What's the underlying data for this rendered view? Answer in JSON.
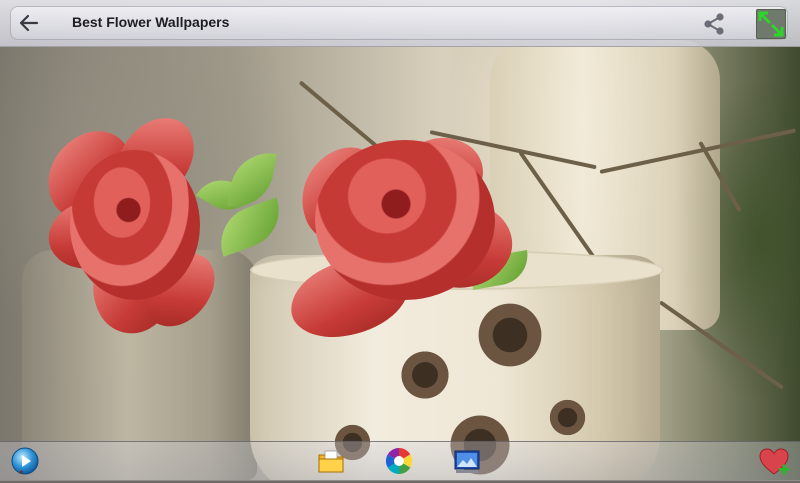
{
  "app": {
    "title": "Best Flower Wallpapers"
  },
  "topbar": {
    "back_icon": "arrow-left-icon",
    "share_icon": "share-icon",
    "fit_icon": "expand-arrows-icon"
  },
  "bottombar": {
    "items": [
      {
        "icon": "play-icon"
      },
      {
        "icon": "folder-icon"
      },
      {
        "icon": "color-wheel-icon"
      },
      {
        "icon": "set-wallpaper-icon"
      },
      {
        "icon": "favorite-add-icon"
      }
    ]
  },
  "colors": {
    "rose": "#c63a36",
    "fit_button_arrows": "#2fd42a",
    "favorite_heart": "#d9434b"
  }
}
